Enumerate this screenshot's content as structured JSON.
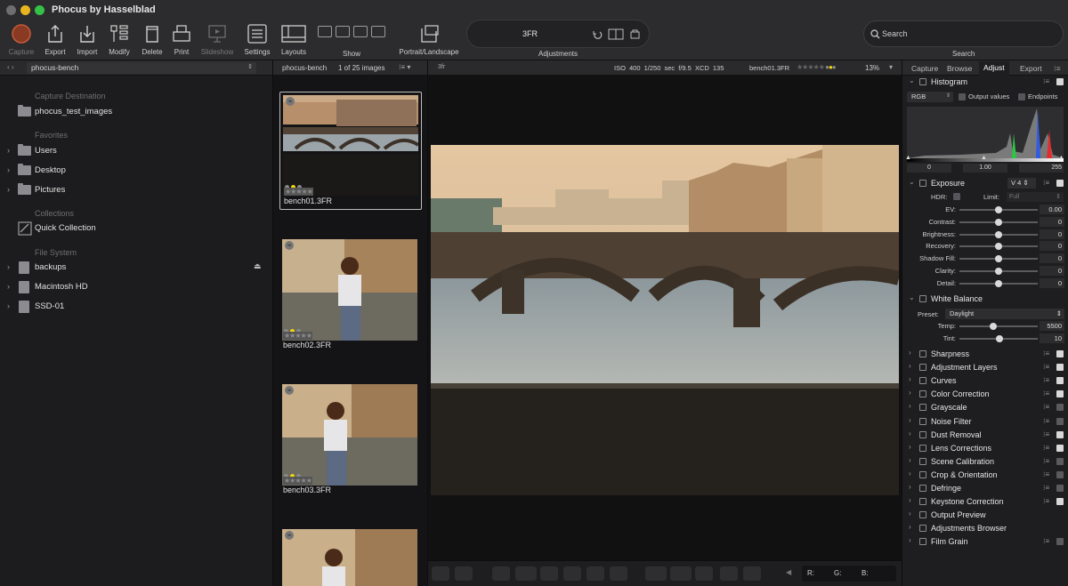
{
  "app": {
    "title": "Phocus by Hasselblad"
  },
  "toolbar": {
    "buttons": [
      {
        "label": "Capture",
        "icon": "capture-icon"
      },
      {
        "label": "Export",
        "icon": "export-icon"
      },
      {
        "label": "Import",
        "icon": "import-icon"
      },
      {
        "label": "Modify",
        "icon": "modify-icon"
      },
      {
        "label": "Delete",
        "icon": "trash-icon"
      },
      {
        "label": "Print",
        "icon": "printer-icon"
      },
      {
        "label": "Slideshow",
        "icon": "slideshow-icon"
      },
      {
        "label": "Settings",
        "icon": "settings-sliders-icon"
      },
      {
        "label": "Layouts",
        "icon": "layouts-icon"
      },
      {
        "label": "Portrait/Landscape",
        "icon": "portrait-landscape-icon"
      }
    ],
    "show_label": "Show",
    "adjustments_label": "Adjustments",
    "adjustments_format": "3FR",
    "search_placeholder": "Search",
    "search_label": "Search"
  },
  "sidebar": {
    "location": "phocus-bench",
    "sections": {
      "capture_destination": "Capture Destination",
      "favorites": "Favorites",
      "collections": "Collections",
      "file_system": "File System"
    },
    "capture_folder": "phocus_test_images",
    "favorites": [
      "Users",
      "Desktop",
      "Pictures"
    ],
    "collections": [
      "Quick Collection"
    ],
    "file_system": [
      "backups",
      "Macintosh HD",
      "SSD-01"
    ]
  },
  "filmstrip": {
    "folder": "phocus-bench",
    "count": "1 of 25 images",
    "view_toggle": "3fr",
    "thumbnails": [
      {
        "name": "bench01.3FR",
        "badge": "3fr"
      },
      {
        "name": "bench02.3FR",
        "badge": "3fr"
      },
      {
        "name": "bench03.3FR",
        "badge": "3fr"
      },
      {
        "name": "",
        "badge": "3fr"
      }
    ]
  },
  "viewer": {
    "toggle": "3fr",
    "iso": "ISO 400",
    "shutter": "1/250 sec",
    "aperture": "f/9.5",
    "lens": "XCD 135",
    "filename": "bench01.3FR",
    "zoom": "13%",
    "rgb": {
      "r": "R:",
      "g": "G:",
      "b": "B:"
    }
  },
  "right_panel": {
    "tabs": [
      "Capture",
      "Browse",
      "Adjust",
      "Export"
    ],
    "active_tab": "Adjust",
    "histogram": {
      "title": "Histogram",
      "mode": "RGB",
      "output_values": "Output values",
      "endpoints": "Endpoints",
      "scale": [
        "0",
        "1.00",
        "255"
      ]
    },
    "exposure": {
      "title": "Exposure",
      "version": "V 4",
      "hdr_label": "HDR:",
      "limit_label": "Limit:",
      "limit_value": "Full",
      "sliders": [
        {
          "label": "EV:",
          "value": "0.00",
          "position": 0.5
        },
        {
          "label": "Contrast:",
          "value": "0",
          "position": 0.5
        },
        {
          "label": "Brightness:",
          "value": "0",
          "position": 0.5
        },
        {
          "label": "Recovery:",
          "value": "0",
          "position": 0.5
        },
        {
          "label": "Shadow Fill:",
          "value": "0",
          "position": 0.5
        },
        {
          "label": "Clarity:",
          "value": "0",
          "position": 0.5
        },
        {
          "label": "Detail:",
          "value": "0",
          "position": 0.5
        }
      ]
    },
    "white_balance": {
      "title": "White Balance",
      "preset_label": "Preset:",
      "preset_value": "Daylight",
      "sliders": [
        {
          "label": "Temp:",
          "value": "5500",
          "position": 0.43
        },
        {
          "label": "Tint:",
          "value": "10",
          "position": 0.51
        }
      ]
    },
    "tools": [
      {
        "name": "Sharpness",
        "checked": true
      },
      {
        "name": "Adjustment Layers",
        "checked": true
      },
      {
        "name": "Curves",
        "checked": true
      },
      {
        "name": "Color Correction",
        "checked": true
      },
      {
        "name": "Grayscale",
        "checked": false
      },
      {
        "name": "Noise Filter",
        "checked": false
      },
      {
        "name": "Dust Removal",
        "checked": true
      },
      {
        "name": "Lens Corrections",
        "checked": true
      },
      {
        "name": "Scene Calibration",
        "checked": false
      },
      {
        "name": "Crop & Orientation",
        "checked": false
      },
      {
        "name": "Defringe",
        "checked": false
      },
      {
        "name": "Keystone Correction",
        "checked": true
      },
      {
        "name": "Output Preview",
        "checked": null
      },
      {
        "name": "Adjustments Browser",
        "checked": null
      },
      {
        "name": "Film Grain",
        "checked": false
      }
    ]
  },
  "colors": {
    "accent_yellow": "#f1d90b",
    "capture_red": "#8a3a22",
    "toolbar_bg": "#2c2c2e"
  }
}
